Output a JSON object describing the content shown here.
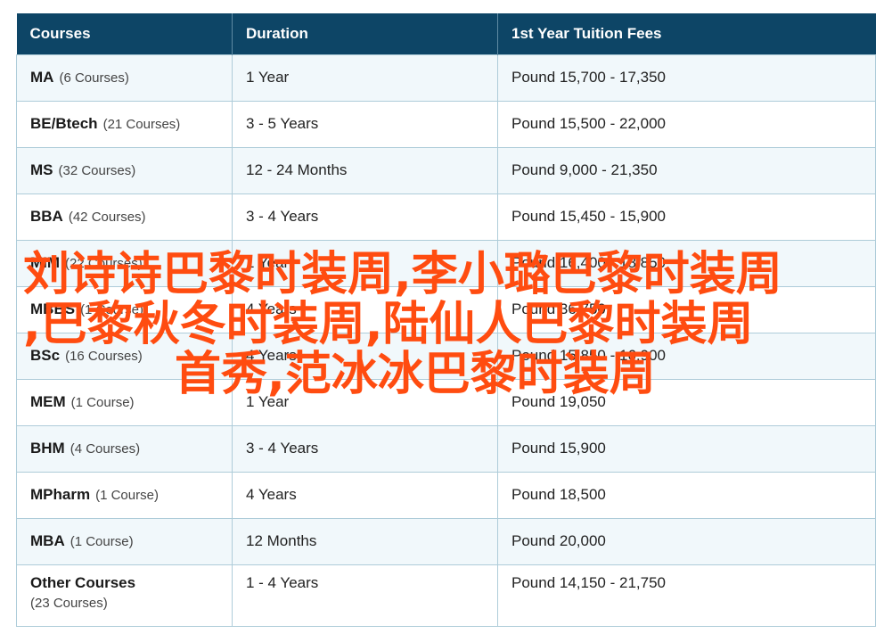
{
  "table": {
    "headers": [
      "Courses",
      "Duration",
      "1st Year Tuition Fees"
    ],
    "rows": [
      {
        "code": "MA",
        "count": "(6 Courses)",
        "duration": "1 Year",
        "fee": "Pound 15,700 - 17,350"
      },
      {
        "code": "BE/Btech",
        "count": "(21 Courses)",
        "duration": "3 - 5 Years",
        "fee": "Pound 15,500 - 22,000"
      },
      {
        "code": "MS",
        "count": "(32 Courses)",
        "duration": "12 - 24 Months",
        "fee": "Pound 9,000 - 21,350"
      },
      {
        "code": "BBA",
        "count": "(42 Courses)",
        "duration": "3 - 4 Years",
        "fee": "Pound 15,450 - 15,900"
      },
      {
        "code": "MIM",
        "count": "(22 Courses)",
        "duration": "1 Year",
        "fee": "Pound 16,400 - 18,850"
      },
      {
        "code": "MBBS",
        "count": "(1 Course)",
        "duration": "4 Years",
        "fee": "Pound 36,750"
      },
      {
        "code": "BSc",
        "count": "(16 Courses)",
        "duration": "4 Years",
        "fee": "Pound 15,850 - 16,900"
      },
      {
        "code": "MEM",
        "count": "(1 Course)",
        "duration": "1 Year",
        "fee": "Pound 19,050"
      },
      {
        "code": "BHM",
        "count": "(4 Courses)",
        "duration": "3 - 4 Years",
        "fee": "Pound 15,900"
      },
      {
        "code": "MPharm",
        "count": "(1 Course)",
        "duration": "4 Years",
        "fee": "Pound 18,500"
      },
      {
        "code": "MBA",
        "count": "(1 Course)",
        "duration": "12 Months",
        "fee": "Pound 20,000"
      },
      {
        "code": "Other Courses",
        "count": "(23 Courses)",
        "duration": "1 - 4 Years",
        "fee": "Pound 14,150 - 21,750"
      }
    ]
  },
  "overlay": {
    "lines": [
      "刘诗诗巴黎时装周,李小璐巴黎时装周",
      ",巴黎秋冬时装周,陆仙人巴黎时装周",
      "首秀,范冰冰巴黎时装周"
    ],
    "color": "#ff4c10"
  },
  "colors": {
    "header_bg": "#0d4566",
    "row_alt_bg": "#f1f8fb",
    "border": "#aeccd9"
  }
}
